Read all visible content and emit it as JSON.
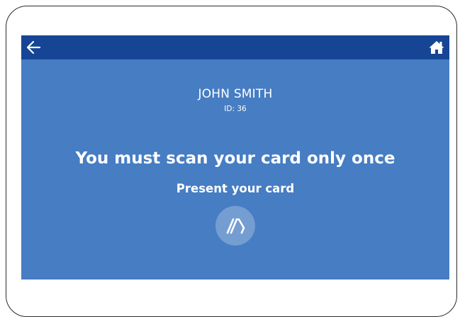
{
  "topbar": {
    "back_icon": "arrow-left-icon",
    "home_icon": "home-icon"
  },
  "user": {
    "name": "JOHN SMITH",
    "id_text": "ID: 36"
  },
  "message": {
    "title": "You must scan your card only once",
    "prompt": "Present your card"
  },
  "card_icon": "contactless-card-icon",
  "colors": {
    "screen_background": "#467dc3",
    "topbar_background": "#154594",
    "text": "#ffffff"
  }
}
